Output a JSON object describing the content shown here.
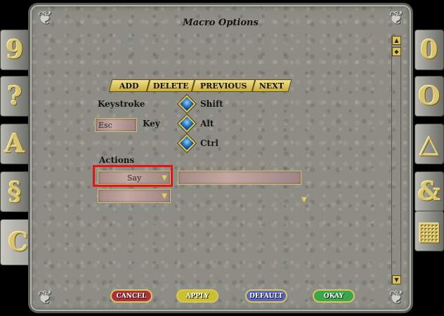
{
  "window": {
    "title": "Macro Options"
  },
  "side_tabs": {
    "left": [
      {
        "name": "tab-left-1",
        "glyph": "9"
      },
      {
        "name": "tab-left-2",
        "glyph": "?"
      },
      {
        "name": "tab-left-3",
        "glyph": "A"
      },
      {
        "name": "tab-left-4",
        "glyph": "§"
      },
      {
        "name": "tab-left-5",
        "glyph": "C"
      }
    ],
    "right": [
      {
        "name": "tab-right-1",
        "glyph": "0"
      },
      {
        "name": "tab-right-2",
        "glyph": "O"
      },
      {
        "name": "tab-right-3",
        "glyph": "△"
      },
      {
        "name": "tab-right-4",
        "glyph": "&"
      },
      {
        "name": "tab-right-5",
        "glyph": "▦"
      }
    ]
  },
  "toolbar": {
    "add": "ADD",
    "delete": "DELETE",
    "previous": "PREVIOUS",
    "next": "NEXT"
  },
  "keystroke": {
    "label": "Keystroke",
    "key_label": "Key",
    "key_value": "Esc",
    "modifiers": [
      "Shift",
      "Alt",
      "Ctrl"
    ]
  },
  "actions": {
    "label": "Actions",
    "action_1": "Say",
    "action_1_text": "",
    "action_2": ""
  },
  "footer": {
    "cancel": "CANCEL",
    "apply": "APPLY",
    "default": "DEFAULT",
    "okay": "OKAY"
  },
  "colors": {
    "cancel": "#b0303a",
    "apply": "#c9c030",
    "default": "#5a66c0",
    "okay": "#3aa84a",
    "highlight": "#e01616"
  }
}
